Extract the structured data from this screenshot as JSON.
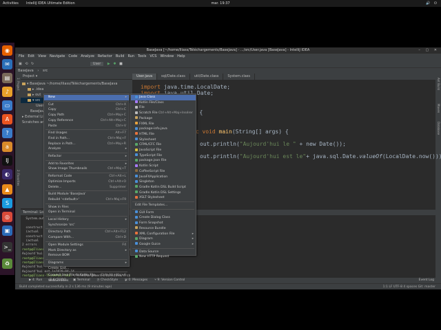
{
  "topbar": {
    "activities": "Activities",
    "app_name": "IntelliJ IDEA Ultimate Edition",
    "clock": "mar. 19:37",
    "tray": "🔊 ⏻"
  },
  "window": {
    "title": "BaseJava [~/home/Iliass/Téléchargements/BaseJava] - .../src/User.java [BaseJava] - IntelliJ IDEA",
    "controls": "– ▢ ✕"
  },
  "menubar": [
    "File",
    "Edit",
    "View",
    "Navigate",
    "Code",
    "Analyze",
    "Refactor",
    "Build",
    "Run",
    "Tools",
    "VCS",
    "Window",
    "Help"
  ],
  "toolbar": {
    "project": "BaseJava",
    "path": "src",
    "run_config": "User"
  },
  "project_panel": {
    "header": "Project ▾",
    "items": [
      {
        "label": "▾ BaseJava ~/home/Iliass/Téléchargements/BaseJava",
        "indent": 2,
        "folder": true,
        "selected": false
      },
      {
        "label": "▸ .idea",
        "indent": 10,
        "folder": true,
        "selected": false
      },
      {
        "label": "▸ out",
        "indent": 10,
        "folder": true,
        "selected": false
      },
      {
        "label": "▾ src",
        "indent": 10,
        "folder": true,
        "selected": true
      },
      {
        "label": "User",
        "indent": 22,
        "folder": false,
        "selected": false
      },
      {
        "label": "BaseJava.iml",
        "indent": 14,
        "folder": false,
        "selected": false
      },
      {
        "label": "▸ External Libraries",
        "indent": 2,
        "folder": false,
        "selected": false
      },
      {
        "label": "Scratches and Consoles",
        "indent": 2,
        "folder": false,
        "selected": false
      }
    ]
  },
  "editor_tabs": [
    {
      "label": "User.java",
      "active": true
    },
    {
      "label": "sql/Date.class",
      "active": false
    },
    {
      "label": "util/Date.class",
      "active": false
    },
    {
      "label": "System.class",
      "active": false
    }
  ],
  "code": {
    "l1_kw": "import",
    "l1_rest": " java.time.LocalDate;",
    "l2_kw": "import",
    "l2_rest": " java.util.Date;",
    "l3": "er {",
    "l4_pre": "ic ",
    "l4_kw": "void ",
    "l4_fn": "main",
    "l4_rest": "(String[] args) {",
    "l5_pre": "out.println(",
    "l5_str": "\"Aujourd'hui le \"",
    "l5_rest": " + new Date());",
    "l6_pre": "out.println(",
    "l6_str": "\"Aujourd'hui est le\"",
    "l6_mid": "+ java.sql.Date.",
    "l6_it": "valueOf",
    "l6_rest": "(LocalDate.now()));"
  },
  "terminal": {
    "header": "Terminal:  Local  +",
    "lines": [
      {
        "prompt": "",
        "text": "  System.out.print"
      },
      {
        "prompt": "",
        "text": ""
      },
      {
        "prompt": "",
        "text": "  construct"
      },
      {
        "prompt": "",
        "text": "  (actual"
      },
      {
        "prompt": "",
        "text": "  construct"
      },
      {
        "prompt": "",
        "text": "  (actual"
      },
      {
        "prompt": "",
        "text": "2 errors"
      },
      {
        "prompt": "rootp@Iliass-ThinkPad-T440:",
        "text": "~/Téléchargements/BaseJava/src$ java User"
      },
      {
        "prompt": "",
        "text": "Aujourd'hui le Tue"
      },
      {
        "prompt": "rootp@Iliass-ThinkPad-T440:",
        "text": ""
      },
      {
        "prompt": "rootp@Iliass-ThinkPad-T440:",
        "text": ""
      },
      {
        "prompt": "",
        "text": "Aujourd'hui le Tue"
      },
      {
        "prompt": "",
        "text": "Aujourd'hui est le2020-04-14"
      },
      {
        "prompt": "rootp@Iliass-ThinkPad-T440:",
        "text": "~/Téléchargements/BaseJava/src$ "
      }
    ]
  },
  "bottom_tabs": [
    "▶ 4: Run",
    "☰ 6: TODO",
    "▣ Terminal",
    "◷ CheckStyle",
    "✉ 0: Messages",
    "⑂ 9: Version Control"
  ],
  "bottom_right": "Event Log",
  "status": {
    "left": "Build completed successfully in 2 s 136 ms (9 minutes ago)",
    "right": "1:1  LF  UTF-8  4 spaces  Git: master"
  },
  "context_menu": {
    "items": [
      {
        "label": "New",
        "shortcut": "",
        "arrow": true,
        "hl": true
      },
      {
        "sep": true
      },
      {
        "label": "Cut",
        "shortcut": "Ctrl+X",
        "arrow": false
      },
      {
        "label": "Copy",
        "shortcut": "Ctrl+C",
        "arrow": false
      },
      {
        "label": "Copy Path",
        "shortcut": "Ctrl+Maj+C",
        "arrow": false
      },
      {
        "label": "Copy Reference",
        "shortcut": "Ctrl+Alt+Maj+C",
        "arrow": false
      },
      {
        "label": "Paste",
        "shortcut": "Ctrl+V",
        "arrow": false
      },
      {
        "sep": true
      },
      {
        "label": "Find Usages",
        "shortcut": "Alt+F7",
        "arrow": false
      },
      {
        "label": "Find in Path...",
        "shortcut": "Ctrl+Maj+F",
        "arrow": false
      },
      {
        "label": "Replace in Path...",
        "shortcut": "Ctrl+Maj+R",
        "arrow": false
      },
      {
        "label": "Analyze",
        "shortcut": "",
        "arrow": true
      },
      {
        "sep": true
      },
      {
        "label": "Refactor",
        "shortcut": "",
        "arrow": true
      },
      {
        "sep": true
      },
      {
        "label": "Add to Favorites",
        "shortcut": "",
        "arrow": true
      },
      {
        "label": "Show Image Thumbnails",
        "shortcut": "Ctrl+Maj+T",
        "arrow": false
      },
      {
        "sep": true
      },
      {
        "label": "Reformat Code",
        "shortcut": "Ctrl+Alt+L",
        "arrow": false
      },
      {
        "label": "Optimize Imports",
        "shortcut": "Ctrl+Alt+O",
        "arrow": false
      },
      {
        "label": "Delete...",
        "shortcut": "Supprimer",
        "arrow": false
      },
      {
        "sep": true
      },
      {
        "label": "Build Module 'BaseJava'",
        "shortcut": "",
        "arrow": false
      },
      {
        "label": "Rebuild '<default>'",
        "shortcut": "Ctrl+Maj+F9",
        "arrow": false
      },
      {
        "sep": true
      },
      {
        "label": "Show in Files",
        "shortcut": "",
        "arrow": false
      },
      {
        "label": "Open in Terminal",
        "shortcut": "",
        "arrow": false
      },
      {
        "sep": true
      },
      {
        "label": "Local History",
        "shortcut": "",
        "arrow": true
      },
      {
        "label": "Synchronize 'src'",
        "shortcut": "",
        "arrow": false
      },
      {
        "sep": true
      },
      {
        "label": "Directory Path",
        "shortcut": "Ctrl+Alt+F12",
        "arrow": false
      },
      {
        "label": "Compare With...",
        "shortcut": "Ctrl+D",
        "arrow": false
      },
      {
        "sep": true
      },
      {
        "label": "Open Module Settings",
        "shortcut": "F4",
        "arrow": false
      },
      {
        "label": "Mark Directory as",
        "shortcut": "",
        "arrow": true
      },
      {
        "label": "Remove BOM",
        "shortcut": "",
        "arrow": false
      },
      {
        "sep": true
      },
      {
        "label": "Diagrams",
        "shortcut": "",
        "arrow": true
      },
      {
        "label": "Create Gist...",
        "shortcut": "",
        "arrow": false
      },
      {
        "sep": true
      },
      {
        "label": "Convert Java File to Kotlin File",
        "shortcut": "Ctrl+Alt+Maj+K",
        "arrow": false
      },
      {
        "label": "WebServices",
        "shortcut": "",
        "arrow": true
      }
    ]
  },
  "submenu": {
    "items": [
      {
        "label": "Java Class",
        "shortcut": "",
        "arrow": false,
        "hl": true,
        "color": "#4a90d9"
      },
      {
        "label": "Kotlin File/Class",
        "shortcut": "",
        "arrow": false,
        "color": "#a97bff"
      },
      {
        "label": "File",
        "shortcut": "",
        "arrow": false,
        "color": "#bbbbbb"
      },
      {
        "label": "Scratch File",
        "shortcut": "Ctrl+Alt+Maj+Insérer",
        "arrow": false,
        "color": "#bbbbbb"
      },
      {
        "label": "Package",
        "shortcut": "",
        "arrow": false,
        "color": "#c9a45d"
      },
      {
        "label": "FXML File",
        "shortcut": "",
        "arrow": false,
        "color": "#e8a33d"
      },
      {
        "label": "package-info.java",
        "shortcut": "",
        "arrow": false,
        "color": "#4a90d9"
      },
      {
        "label": "HTML File",
        "shortcut": "",
        "arrow": false,
        "color": "#e8743d"
      },
      {
        "label": "Stylesheet",
        "shortcut": "",
        "arrow": false,
        "color": "#4a90d9"
      },
      {
        "label": "CFML/CFC File",
        "shortcut": "",
        "arrow": false,
        "color": "#59a869"
      },
      {
        "label": "JavaScript File",
        "shortcut": "",
        "arrow": false,
        "color": "#d9c13d"
      },
      {
        "label": "TypeScript File",
        "shortcut": "",
        "arrow": false,
        "color": "#4a90d9"
      },
      {
        "label": "package.json File",
        "shortcut": "",
        "arrow": false,
        "color": "#59a869"
      },
      {
        "label": "Kotlin Script",
        "shortcut": "",
        "arrow": false,
        "color": "#a97bff"
      },
      {
        "label": "CoffeeScript File",
        "shortcut": "",
        "arrow": false,
        "color": "#8b6a3d"
      },
      {
        "label": "JavaFXApplication",
        "shortcut": "",
        "arrow": false,
        "color": "#4a90d9"
      },
      {
        "label": "Singleton",
        "shortcut": "",
        "arrow": false,
        "color": "#4a90d9"
      },
      {
        "label": "Gradle Kotlin DSL Build Script",
        "shortcut": "",
        "arrow": false,
        "color": "#59a869"
      },
      {
        "label": "Gradle Kotlin DSL Settings",
        "shortcut": "",
        "arrow": false,
        "color": "#59a869"
      },
      {
        "label": "XSLT Stylesheet",
        "shortcut": "",
        "arrow": false,
        "color": "#e8743d"
      },
      {
        "sep": true
      },
      {
        "label": "Edit File Templates...",
        "shortcut": "",
        "arrow": false,
        "color": ""
      },
      {
        "sep": true
      },
      {
        "label": "GUI Form",
        "shortcut": "",
        "arrow": false,
        "color": "#4a90d9"
      },
      {
        "label": "Create Dialog Class",
        "shortcut": "",
        "arrow": false,
        "color": "#4a90d9"
      },
      {
        "label": "Form Snapshot",
        "shortcut": "",
        "arrow": false,
        "color": "#4a90d9"
      },
      {
        "label": "Resource Bundle",
        "shortcut": "",
        "arrow": false,
        "color": "#c9a45d"
      },
      {
        "label": "XML Configuration File",
        "shortcut": "",
        "arrow": true,
        "color": "#e8743d"
      },
      {
        "label": "Diagram",
        "shortcut": "",
        "arrow": true,
        "color": "#59a869"
      },
      {
        "label": "Google Guice",
        "shortcut": "",
        "arrow": true,
        "color": "#4a90d9"
      },
      {
        "sep": true
      },
      {
        "label": "Data Source",
        "shortcut": "",
        "arrow": false,
        "color": "#4a90d9"
      },
      {
        "label": "New HTTP Request",
        "shortcut": "",
        "arrow": false,
        "color": "#59a869"
      }
    ]
  },
  "dock_icons": [
    {
      "name": "firefox-icon",
      "glyph": "◉",
      "color": "#e66000"
    },
    {
      "name": "thunderbird-icon",
      "glyph": "✉",
      "color": "#2a6fb8"
    },
    {
      "name": "files-icon",
      "glyph": "▤",
      "color": "#7a6a5a"
    },
    {
      "name": "rhythmbox-icon",
      "glyph": "♪",
      "color": "#e8a02a"
    },
    {
      "name": "libreoffice-writer-icon",
      "glyph": "▭",
      "color": "#3a7bc8"
    },
    {
      "name": "software-center-icon",
      "glyph": "A",
      "color": "#e95420"
    },
    {
      "name": "help-icon",
      "glyph": "?",
      "color": "#3a7bc8"
    },
    {
      "name": "amazon-icon",
      "glyph": "a",
      "color": "#d98a2a"
    },
    {
      "name": "intellij-icon",
      "glyph": "IJ",
      "color": "#111111"
    },
    {
      "name": "eclipse-icon",
      "glyph": "◐",
      "color": "#3b2a6a"
    },
    {
      "name": "vlc-icon",
      "glyph": "▲",
      "color": "#e88a1a"
    },
    {
      "name": "skype-icon",
      "glyph": "S",
      "color": "#1a9ae0"
    },
    {
      "name": "chrome-icon",
      "glyph": "◎",
      "color": "#d94a3a"
    },
    {
      "name": "virtualbox-icon",
      "glyph": "▣",
      "color": "#2a6ab8"
    },
    {
      "name": "terminal-icon",
      "glyph": ">_",
      "color": "#333333"
    },
    {
      "name": "trash-icon",
      "glyph": "♻",
      "color": "#5a8a3a"
    }
  ]
}
